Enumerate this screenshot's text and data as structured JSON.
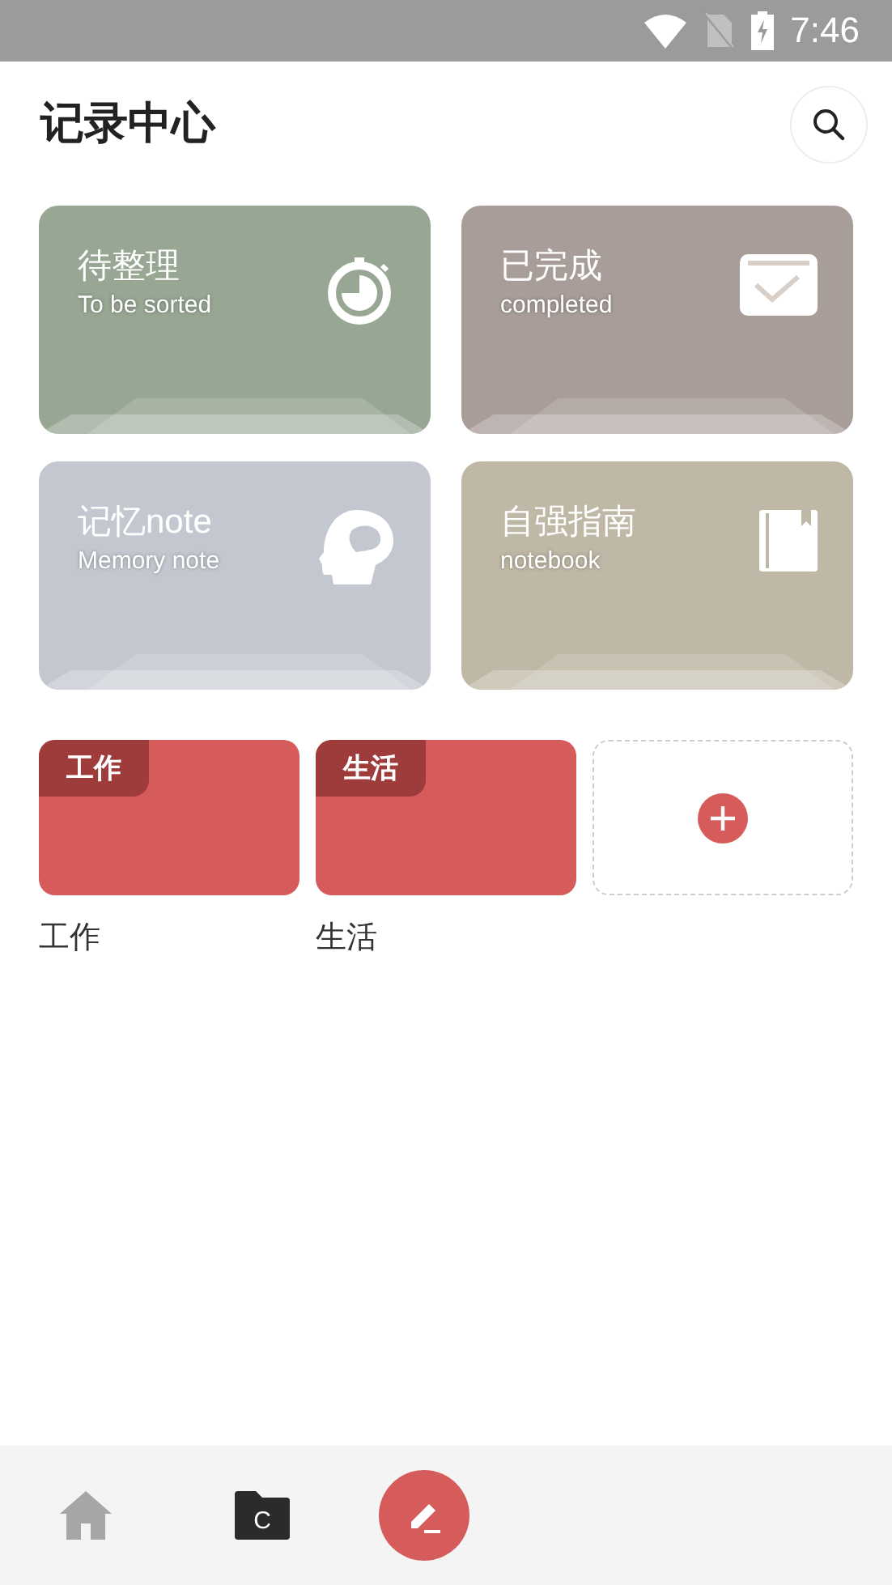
{
  "status_bar": {
    "time": "7:46"
  },
  "header": {
    "title": "记录中心"
  },
  "categories": [
    {
      "title": "待整理",
      "subtitle": "To be sorted",
      "kind": "timer",
      "color": "#98a794"
    },
    {
      "title": "已完成",
      "subtitle": "completed",
      "kind": "done",
      "color": "#a89d98"
    },
    {
      "title": "记忆note",
      "subtitle": "Memory note",
      "kind": "memory",
      "color": "#c3c8d0"
    },
    {
      "title": "自强指南",
      "subtitle": "notebook",
      "kind": "book",
      "color": "#c0b8a6"
    }
  ],
  "notebooks": [
    {
      "tag": "工作",
      "name": "工作"
    },
    {
      "tag": "生活",
      "name": "生活"
    }
  ],
  "bottom_nav": [
    {
      "kind": "home",
      "selected": false
    },
    {
      "kind": "folder",
      "label": "C",
      "selected": true
    },
    {
      "kind": "write",
      "selected": false
    }
  ]
}
